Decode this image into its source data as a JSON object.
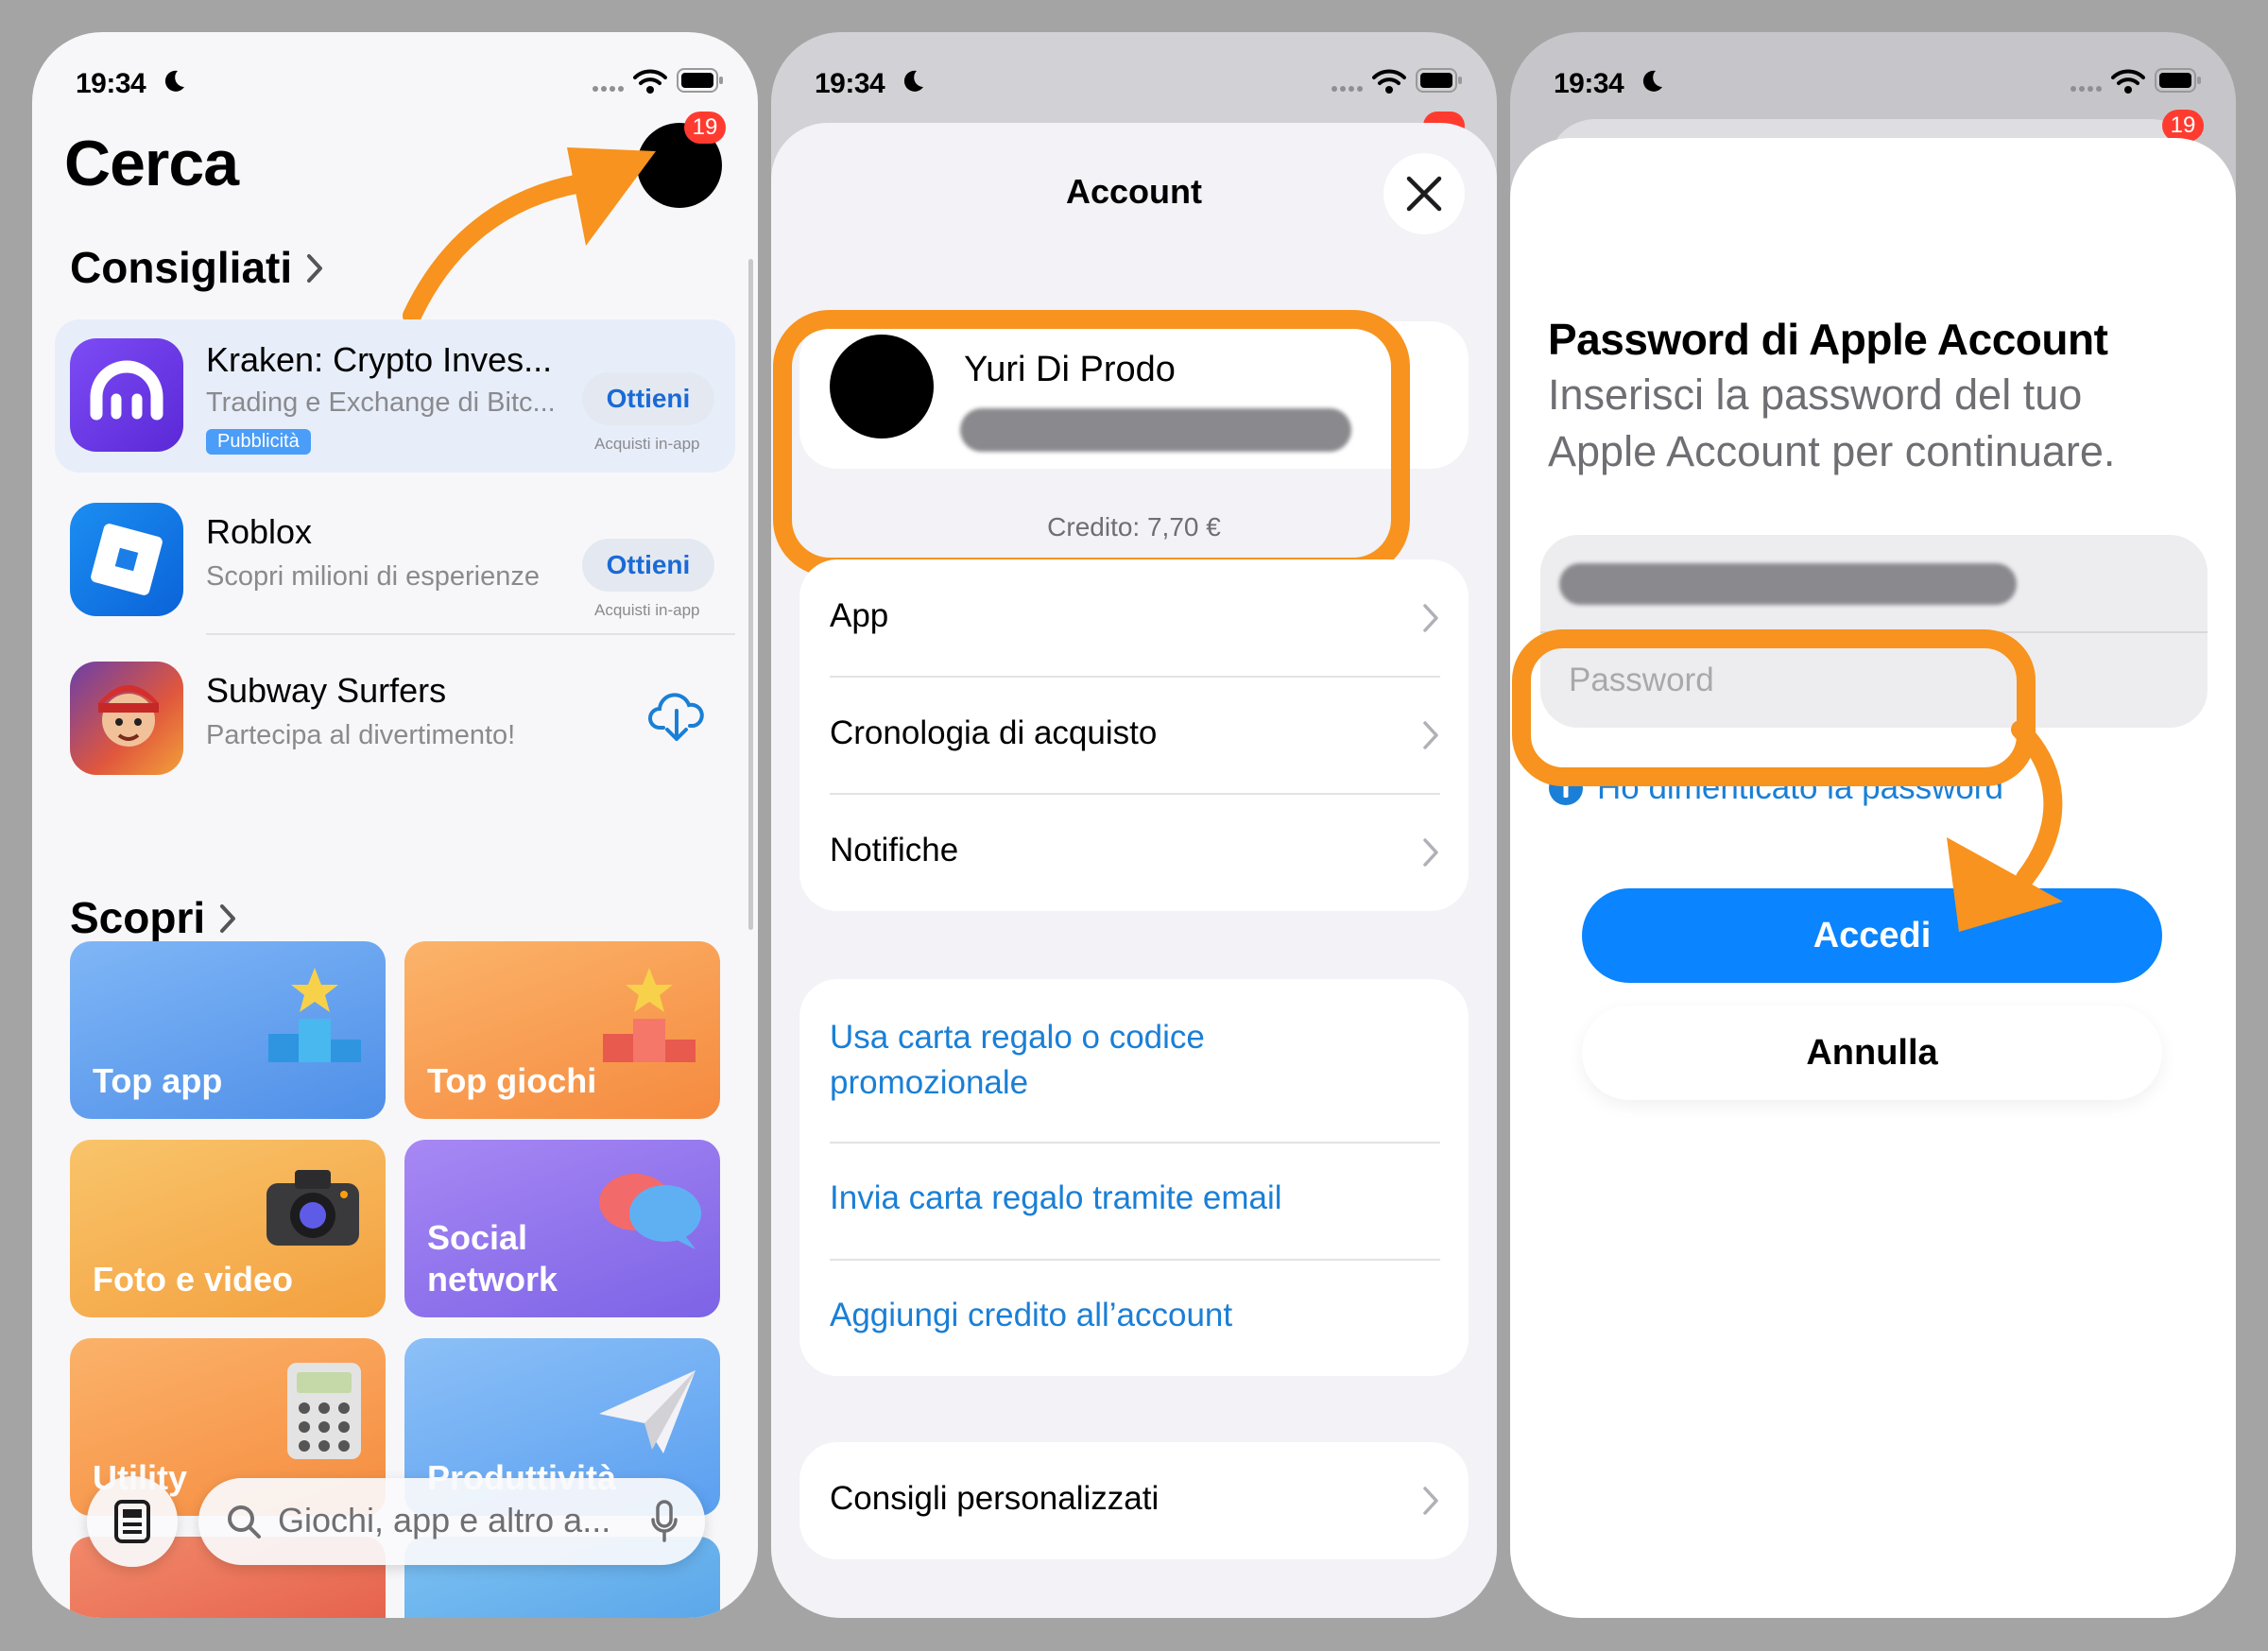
{
  "status_bar": {
    "time": "19:34"
  },
  "screen1": {
    "title": "Cerca",
    "badge": "19",
    "section_recommended": "Consigliati",
    "apps": [
      {
        "name": "Kraken: Crypto Inves...",
        "subtitle": "Trading e Exchange di Bitc...",
        "tag": "Pubblicità",
        "button": "Ottieni",
        "note": "Acquisti in-app",
        "icon": "kraken-icon"
      },
      {
        "name": "Roblox",
        "subtitle": "Scopri milioni di esperienze",
        "button": "Ottieni",
        "note": "Acquisti in-app",
        "icon": "roblox-icon"
      },
      {
        "name": "Subway Surfers",
        "subtitle": "Partecipa al divertimento!",
        "button_icon": "cloud-download-icon",
        "icon": "subway-surfers-icon"
      }
    ],
    "section_discover": "Scopri",
    "categories": [
      "Top app",
      "Top giochi",
      "Foto e video",
      "Social network",
      "Utility",
      "Produttività"
    ],
    "search_placeholder": "Giochi, app e altro a..."
  },
  "screen2": {
    "title": "Account",
    "user_name": "Yuri Di Prodo",
    "credit": "Credito: 7,70 €",
    "menu1": [
      "App",
      "Cronologia di acquisto",
      "Notifiche"
    ],
    "links": [
      "Usa carta regalo o codice promozionale",
      "Invia carta regalo tramite email",
      "Aggiungi credito all’account"
    ],
    "menu3": [
      "Consigli personalizzati"
    ]
  },
  "screen3": {
    "badge": "19",
    "title": "Password di Apple Account",
    "description": "Inserisci la password del tuo Apple Account per continuare.",
    "password_placeholder": "Password",
    "forgot": "Ho dimenticato la password",
    "primary_button": "Accedi",
    "secondary_button": "Annulla"
  },
  "colors": {
    "accent": "#0a84ff",
    "link": "#1a7fd6",
    "highlight": "#f7931e",
    "badge": "#ff3b30"
  }
}
